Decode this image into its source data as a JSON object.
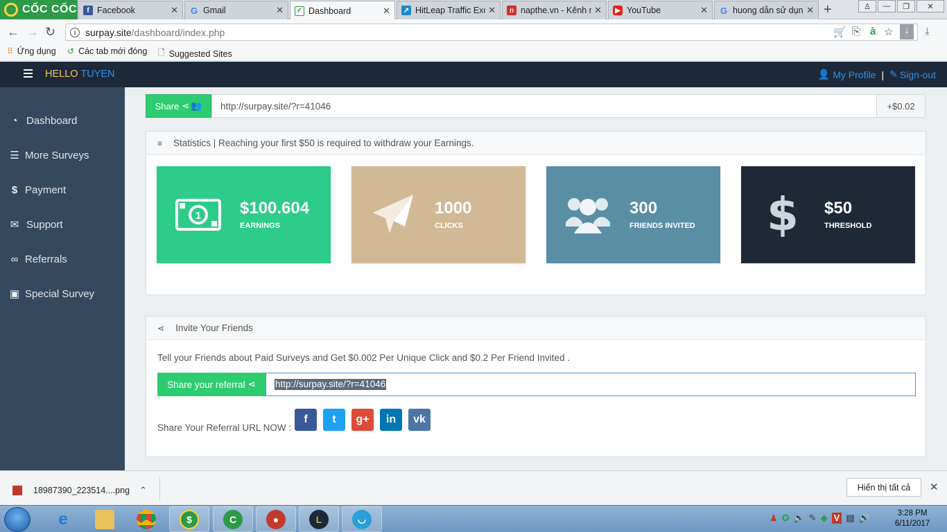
{
  "browser": {
    "brand": "CỐC CỐC",
    "tabs": [
      {
        "label": "Facebook",
        "icon": "facebook-icon",
        "color": "#3b5998"
      },
      {
        "label": "Gmail",
        "icon": "google-icon",
        "color": "#4285f4"
      },
      {
        "label": "Dashboard",
        "icon": "check-icon",
        "color": "#2d9a47"
      },
      {
        "label": "HitLeap Traffic Exc",
        "icon": "arrow-icon",
        "color": "#1e88c7"
      },
      {
        "label": "napthe.vn - Kênh r",
        "icon": "napthe-icon",
        "color": "#d32f2f"
      },
      {
        "label": "YouTube",
        "icon": "youtube-icon",
        "color": "#e62117"
      },
      {
        "label": "huong dẫn sử dụn",
        "icon": "google-icon",
        "color": "#4285f4"
      }
    ],
    "url_host": "surpay.site",
    "url_path": "/dashboard/index.php",
    "bookmarks": [
      {
        "label": "Ứng dụng",
        "icon": "apps-icon"
      },
      {
        "label": "Các tab mới đóng",
        "icon": "history-icon"
      },
      {
        "label": "Suggested Sites",
        "icon": "page-icon"
      }
    ]
  },
  "header": {
    "hello_1": "HELLO",
    "hello_2": "TUYEN",
    "profile": "My Profile",
    "separator": "|",
    "signout": "Sign-out"
  },
  "sidebar": {
    "items": [
      {
        "label": "Dashboard",
        "icon": "dashboard-icon"
      },
      {
        "label": "More Surveys",
        "icon": "list-icon"
      },
      {
        "label": "Payment",
        "icon": "dollar-icon"
      },
      {
        "label": "Support",
        "icon": "envelope-icon"
      },
      {
        "label": "Referrals",
        "icon": "link-icon"
      },
      {
        "label": "Special Survey",
        "icon": "money-icon"
      }
    ]
  },
  "share": {
    "label": "Share",
    "url": "http://surpay.site/?r=41046",
    "amount": "+$0.02"
  },
  "stats": {
    "title": "Statistics | Reaching your first $50 is required to withdraw your Earnings.",
    "tiles": [
      {
        "value": "$100.604",
        "caption": "EARNINGS",
        "color": "#2ecc8a"
      },
      {
        "value": "1000",
        "caption": "CLICKS",
        "color": "#d2b996"
      },
      {
        "value": "300",
        "caption": "FRIENDS INVITED",
        "color": "#5a8ea4"
      },
      {
        "value": "$50",
        "caption": "THRESHOLD",
        "color": "#1f2935"
      }
    ]
  },
  "invite": {
    "title": "Invite Your Friends",
    "text": "Tell your Friends about Paid Surveys and Get $0.002 Per Unique Click and $0.2 Per Friend Invited .",
    "ref_label": "Share your referral",
    "ref_url": "http://surpay.site/?r=41046",
    "share_now": "Share Your Referral URL NOW :",
    "socials": [
      {
        "name": "facebook",
        "glyph": "f",
        "color": "#3b5998"
      },
      {
        "name": "twitter",
        "glyph": "t",
        "color": "#1da1f2"
      },
      {
        "name": "google-plus",
        "glyph": "g+",
        "color": "#dd4b39"
      },
      {
        "name": "linkedin",
        "glyph": "in",
        "color": "#0077b5"
      },
      {
        "name": "vk",
        "glyph": "vk",
        "color": "#4c75a3"
      }
    ]
  },
  "downloads": {
    "file": "18987390_223514....png",
    "show_all": "Hiển thị tất cả"
  },
  "taskbar": {
    "time": "3:28 PM",
    "date": "6/11/2017"
  }
}
